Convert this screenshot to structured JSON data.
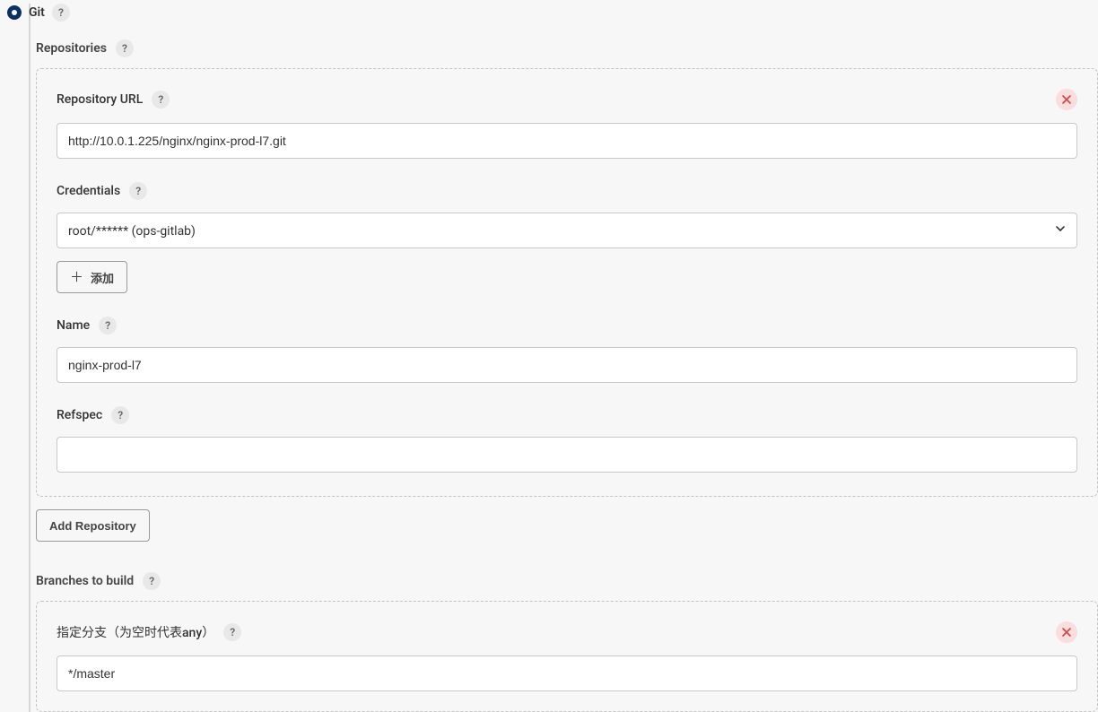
{
  "scm": {
    "git_label": "Git",
    "repositories": {
      "section_label": "Repositories",
      "repo_url_label": "Repository URL",
      "repo_url_value": "http://10.0.1.225/nginx/nginx-prod-l7.git",
      "credentials_label": "Credentials",
      "credentials_value": "root/****** (ops-gitlab)",
      "add_button_label": "添加",
      "name_label": "Name",
      "name_value": "nginx-prod-l7",
      "refspec_label": "Refspec",
      "refspec_value": "",
      "add_repo_label": "Add Repository"
    },
    "branches": {
      "section_label": "Branches to build",
      "branch_spec_label": "指定分支（为空时代表any）",
      "branch_spec_value": "*/master"
    }
  }
}
